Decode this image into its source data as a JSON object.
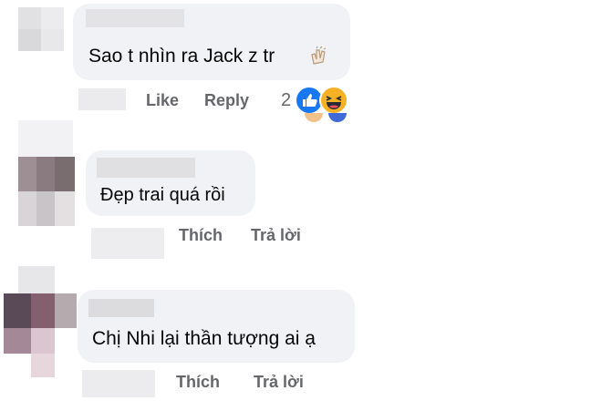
{
  "comments": [
    {
      "text": "Sao t nhìn ra Jack z tr",
      "like_label": "Like",
      "reply_label": "Reply",
      "reaction_count": "2",
      "reactions": [
        "like-icon",
        "haha-icon"
      ],
      "emoji": "clapping-hands-icon"
    },
    {
      "text": "Đẹp trai quá rồi",
      "like_label": "Thích",
      "reply_label": "Trả lời"
    },
    {
      "text": "Chị Nhi lại thần tượng ai ạ",
      "like_label": "Thích",
      "reply_label": "Trả lời"
    }
  ],
  "colors": {
    "bubble": "#f0f2f5",
    "text": "#050505",
    "action": "#65676b",
    "like_blue": "#1877f2",
    "haha_yellow": "#f7b125"
  }
}
